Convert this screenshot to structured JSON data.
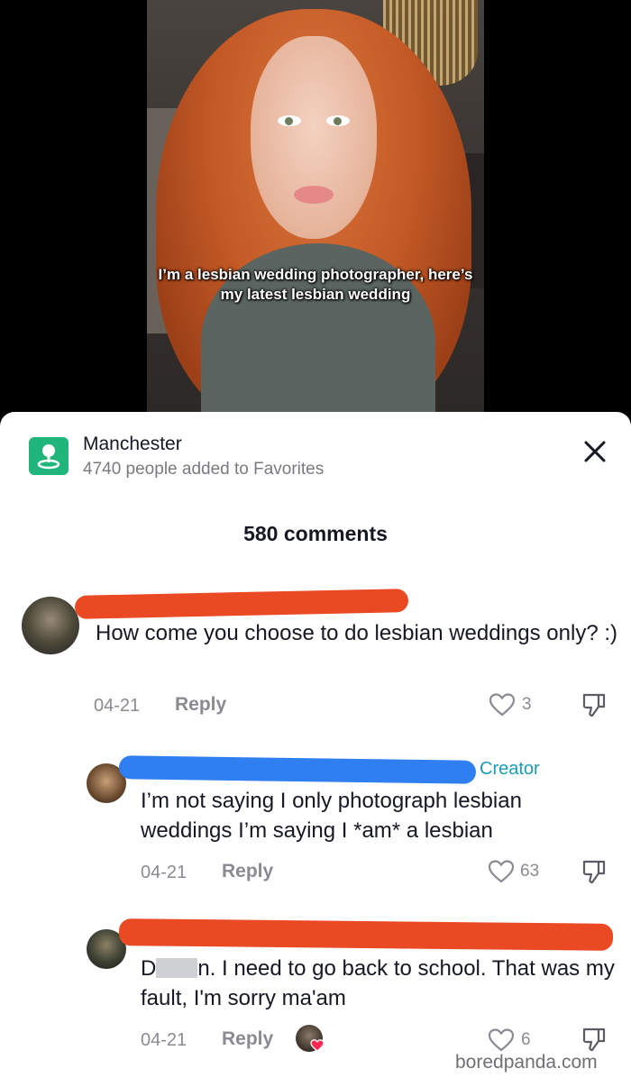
{
  "video": {
    "caption": "I’m a lesbian wedding photographer, here’s my latest lesbian wedding"
  },
  "location": {
    "icon": "location-pin-icon",
    "title": "Manchester",
    "subtitle": "4740 people added to Favorites",
    "accent_color": "#20b57b"
  },
  "comments_header": {
    "count_label": "580 comments"
  },
  "comments": [
    {
      "text": "How come you choose to do lesbian weddings only? :)",
      "date": "04-21",
      "reply_label": "Reply",
      "likes": "3"
    },
    {
      "badge": "Creator",
      "text": "I’m not saying I only photograph lesbian weddings I’m saying I *am* a lesbian",
      "date": "04-21",
      "reply_label": "Reply",
      "likes": "63"
    },
    {
      "text_prefix": "D",
      "text_suffix": "n. I need to go back to school. That was my fault, I'm sorry ma'am",
      "date": "04-21",
      "reply_label": "Reply",
      "likes": "6",
      "liked_by_creator": true
    }
  ],
  "colors": {
    "redaction_red": "#e94a24",
    "redaction_blue": "#2f7ff0",
    "creator_badge": "#1b9cb4",
    "muted_text": "#8a8b91"
  },
  "watermark": "boredpanda.com"
}
